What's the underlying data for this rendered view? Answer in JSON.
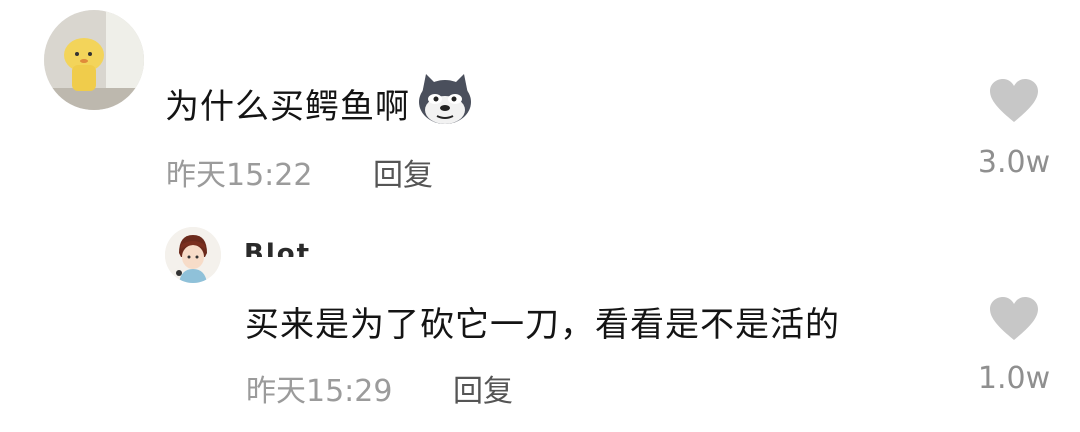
{
  "comments": [
    {
      "username": "",
      "text": "为什么买鳄鱼啊",
      "emoji": "husky-dog-emoji",
      "time": "昨天15:22",
      "reply_label": "回复",
      "like_count": "3.0w",
      "icon": "heart-icon"
    },
    {
      "username": "Blot",
      "text": "买来是为了砍它一刀，看看是不是活的",
      "time": "昨天15:29",
      "reply_label": "回复",
      "like_count": "1.0w",
      "icon": "heart-icon"
    }
  ],
  "colors": {
    "heart": "#c7c7c7",
    "meta": "#9b9b9b",
    "text": "#141414"
  }
}
